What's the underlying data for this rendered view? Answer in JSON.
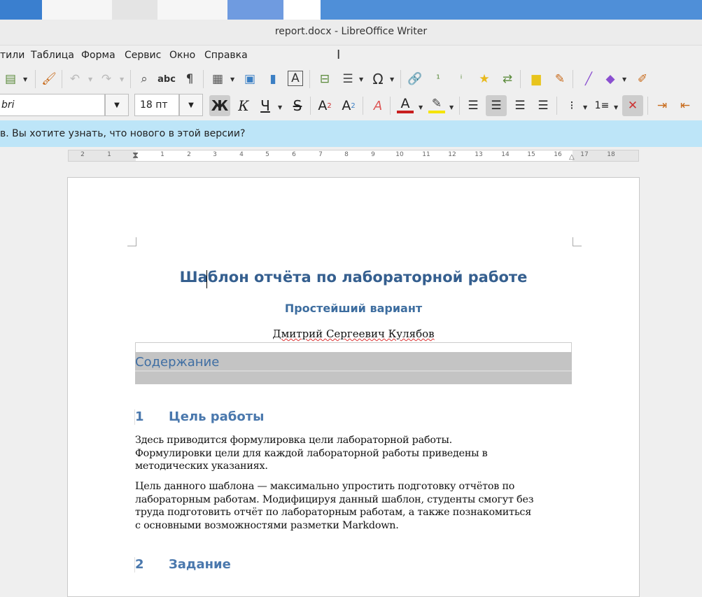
{
  "window": {
    "title": "report.docx - LibreOffice Writer"
  },
  "menu": {
    "items": [
      "тили",
      "Таблица",
      "Форма",
      "Сервис",
      "Окно",
      "Справка"
    ]
  },
  "toolbar": {
    "font_name": "bri",
    "font_size": "18 пт"
  },
  "infobar": {
    "text": "в. Вы хотите узнать, что нового в этой версии?"
  },
  "ruler": {
    "labels": [
      "2",
      "1",
      "1",
      "2",
      "3",
      "4",
      "5",
      "6",
      "7",
      "8",
      "9",
      "10",
      "11",
      "12",
      "13",
      "14",
      "15",
      "16",
      "17",
      "18"
    ]
  },
  "document": {
    "title": "Шаблон отчёта по лабораторной работе",
    "subtitle": "Простейший вариант",
    "author": "Дмитрий Сергеевич Кулябов",
    "toc_label": "Содержание",
    "section1": {
      "num": "1",
      "title": "Цель работы"
    },
    "para1": [
      "Здесь приводится формулировка цели лабораторной работы.",
      "Формулировки цели для каждой лабораторной работы приведены в",
      "методических указаниях."
    ],
    "para2": [
      "Цель данного шаблона — максимально упростить подготовку отчётов по",
      "лабораторным работам. Модифицируя данный шаблон, студенты смогут без",
      "труда подготовить отчёт по лабораторным работам, а также познакомиться",
      "с основными возможностями разметки  Markdown."
    ],
    "section2": {
      "num": "2",
      "title": "Задание"
    }
  },
  "icons": [
    "paste-icon",
    "clone-formatting-icon",
    "undo-icon",
    "redo-icon",
    "find-replace-icon",
    "spelling-icon",
    "formatting-marks-icon",
    "insert-table-icon",
    "insert-image-icon",
    "insert-chart-icon",
    "insert-textbox-icon",
    "insert-page-break-icon",
    "insert-field-icon",
    "special-character-icon",
    "hyperlink-icon",
    "footnote-icon",
    "endnote-icon",
    "bookmark-icon",
    "cross-reference-icon",
    "comment-icon",
    "track-changes-icon",
    "line-icon",
    "basic-shapes-icon",
    "draw-functions-icon"
  ]
}
